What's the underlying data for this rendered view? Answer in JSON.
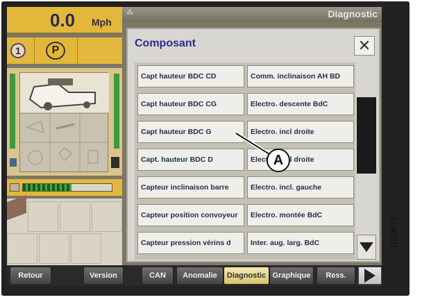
{
  "speed": {
    "value": "0.0",
    "unit": "Mph"
  },
  "gear": {
    "number": "1",
    "park": "P"
  },
  "mini_gauge_fill": 0.55,
  "header": {
    "title": "Diagnostic"
  },
  "dialog": {
    "title": "Composant",
    "close": "✕"
  },
  "items_left": [
    "Capt hauteur BDC CD",
    "Capt hauteur BDC CG",
    "Capt hauteur BDC G",
    "Capt. hauteur BDC D",
    "Capteur inclinaison barre",
    "Capteur position convoyeur",
    "Capteur pression vérins d"
  ],
  "items_right": [
    "Comm. inclinaison AH BD",
    "Electro. descente BdC",
    "Electro. incl droite",
    "Electro. incl droite",
    "Electro. incl. gauche",
    "Electro. montée BdC",
    "Inter. aug. larg. BdC"
  ],
  "callout": "A",
  "tabs": [
    "Retour",
    "Version",
    "CAN",
    "Anomalie",
    "Diagnostic",
    "Graphique",
    "Ress."
  ],
  "figure_number": "1003675",
  "colors": {
    "accent": "#2b2f8f",
    "panel": "#e3b83a"
  }
}
